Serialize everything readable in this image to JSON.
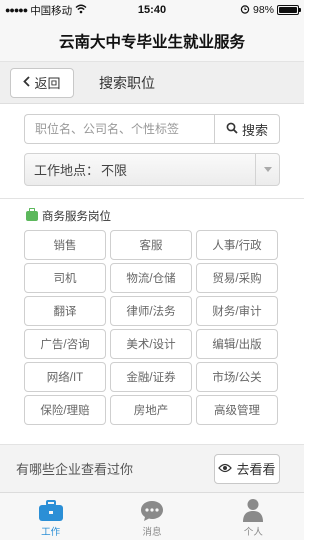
{
  "status": {
    "carrier": "中国移动",
    "time": "15:40",
    "battery": "98%",
    "battery_level": 0.98
  },
  "header": {
    "title": "云南大中专毕业生就业服务"
  },
  "nav": {
    "back_label": "返回",
    "page_title": "搜索职位"
  },
  "search": {
    "placeholder": "职位名、公司名、个性标签",
    "button_label": "搜索"
  },
  "location": {
    "label": "工作地点：",
    "value": "不限"
  },
  "categories": {
    "section_title": "商务服务岗位",
    "items": [
      "销售",
      "客服",
      "人事/行政",
      "司机",
      "物流/仓储",
      "贸易/采购",
      "翻译",
      "律师/法务",
      "财务/审计",
      "广告/咨询",
      "美术/设计",
      "编辑/出版",
      "网络/IT",
      "金融/证券",
      "市场/公关",
      "保险/理赔",
      "房地产",
      "高级管理"
    ]
  },
  "history": {
    "text": "有哪些企业查看过你",
    "button_label": "去看看"
  },
  "tabs": [
    {
      "label": "工作",
      "icon": "briefcase-icon",
      "active": true
    },
    {
      "label": "消息",
      "icon": "chat-bubble-icon",
      "active": false
    },
    {
      "label": "个人",
      "icon": "person-icon",
      "active": false
    }
  ],
  "colors": {
    "accent": "#2b8fd6",
    "section_icon": "#5cb85c"
  }
}
